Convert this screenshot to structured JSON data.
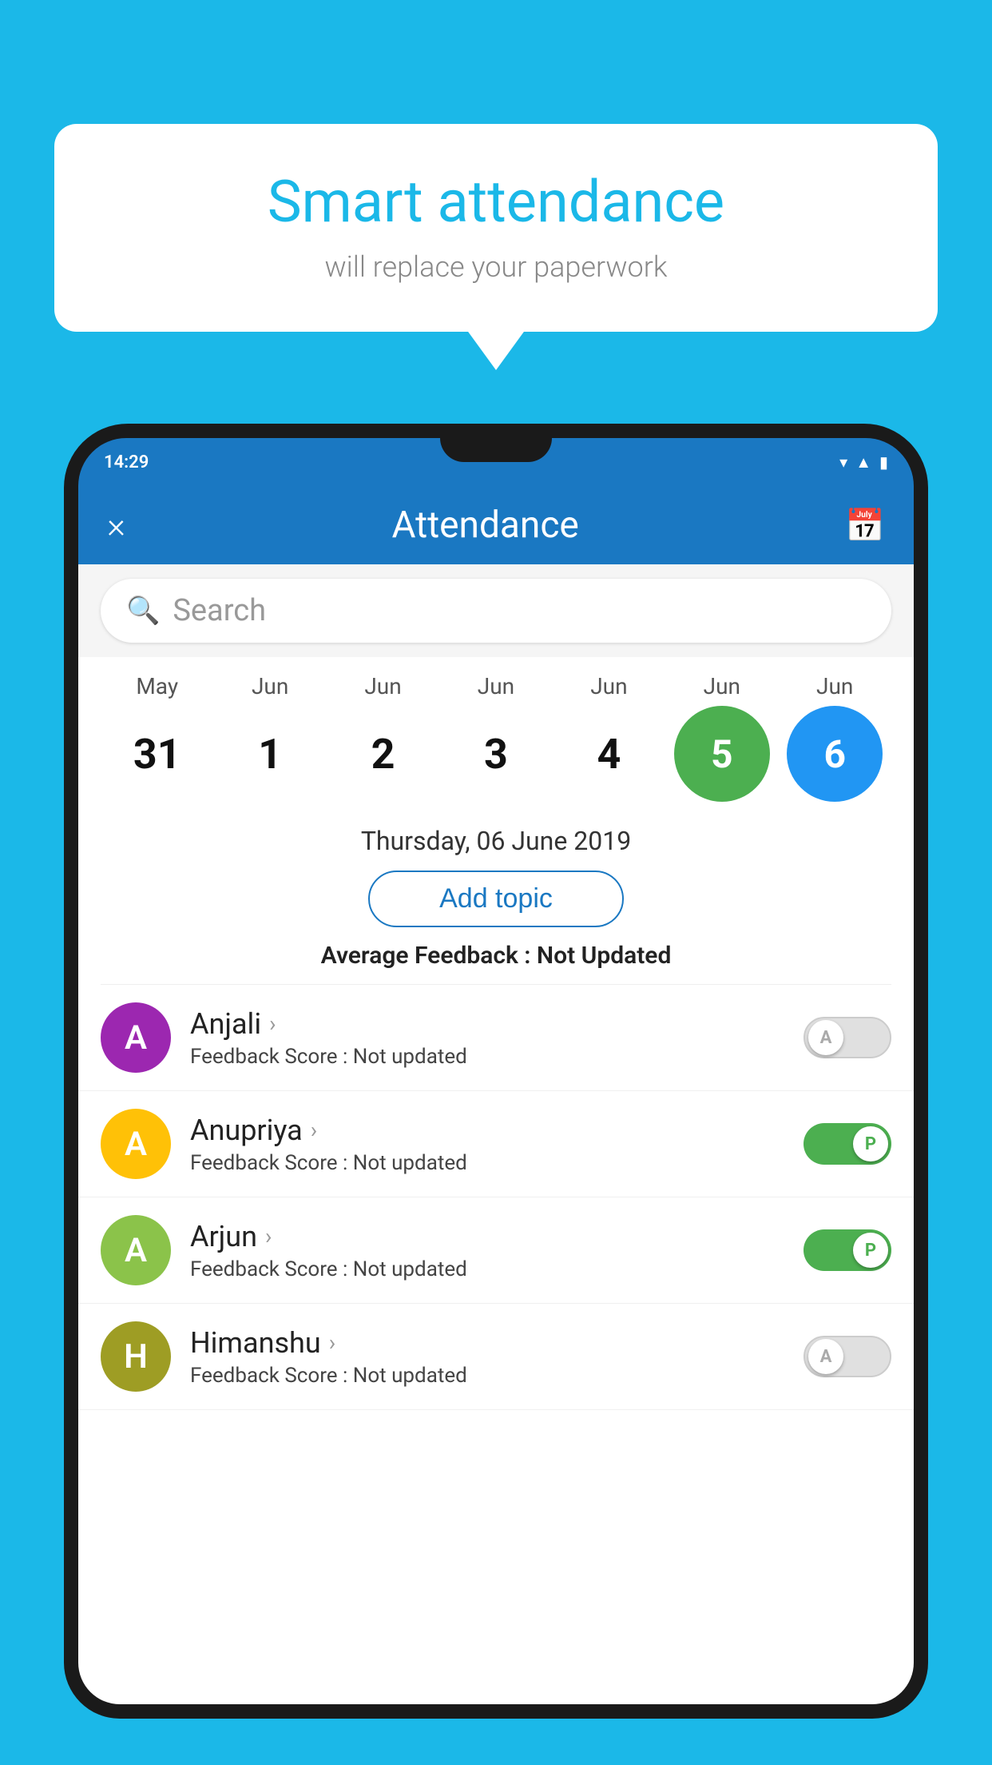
{
  "background_color": "#1BB8E8",
  "speech_bubble": {
    "title": "Smart attendance",
    "subtitle": "will replace your paperwork"
  },
  "phone": {
    "status_bar": {
      "time": "14:29"
    },
    "header": {
      "title": "Attendance",
      "close_label": "×",
      "calendar_icon": "📅"
    },
    "search": {
      "placeholder": "Search"
    },
    "calendar": {
      "months": [
        "May",
        "Jun",
        "Jun",
        "Jun",
        "Jun",
        "Jun",
        "Jun"
      ],
      "days": [
        "31",
        "1",
        "2",
        "3",
        "4",
        "5",
        "6"
      ],
      "selected_green_index": 4,
      "selected_blue_index": 5
    },
    "date_label": "Thursday, 06 June 2019",
    "add_topic_label": "Add topic",
    "avg_feedback_label": "Average Feedback :",
    "avg_feedback_value": "Not Updated",
    "students": [
      {
        "name": "Anjali",
        "avatar_letter": "A",
        "avatar_color": "purple",
        "feedback_label": "Feedback Score :",
        "feedback_value": "Not updated",
        "toggle_state": "off",
        "toggle_letter": "A"
      },
      {
        "name": "Anupriya",
        "avatar_letter": "A",
        "avatar_color": "yellow",
        "feedback_label": "Feedback Score :",
        "feedback_value": "Not updated",
        "toggle_state": "on",
        "toggle_letter": "P"
      },
      {
        "name": "Arjun",
        "avatar_letter": "A",
        "avatar_color": "green",
        "feedback_label": "Feedback Score :",
        "feedback_value": "Not updated",
        "toggle_state": "on",
        "toggle_letter": "P"
      },
      {
        "name": "Himanshu",
        "avatar_letter": "H",
        "avatar_color": "olive",
        "feedback_label": "Feedback Score :",
        "feedback_value": "Not updated",
        "toggle_state": "off",
        "toggle_letter": "A"
      }
    ]
  }
}
